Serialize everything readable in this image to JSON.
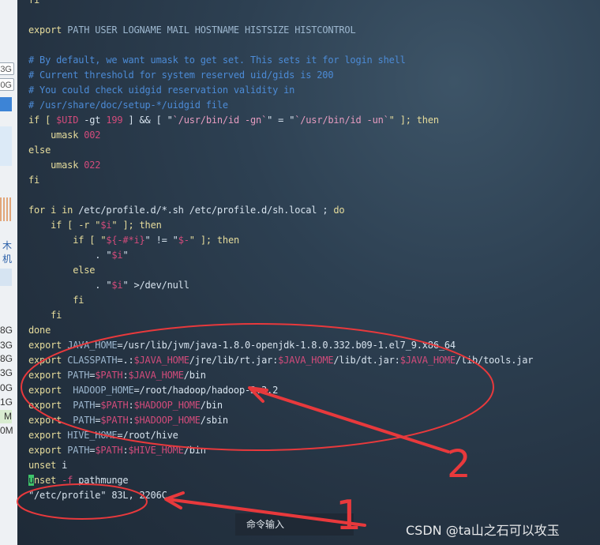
{
  "left_strip": {
    "fields": [
      "3G",
      "0G"
    ],
    "texts": [
      "木机",
      "8G",
      "3G",
      "8G",
      "3G",
      "0G",
      "1G",
      "M",
      "0M"
    ]
  },
  "terminal": {
    "lines": [
      {
        "segs": [
          [
            "fi",
            "kw"
          ]
        ]
      },
      {
        "segs": []
      },
      {
        "segs": [
          [
            "export ",
            "kw"
          ],
          [
            "PATH USER LOGNAME MAIL HOSTNAME HISTSIZE HISTCONTROL",
            "dim"
          ]
        ]
      },
      {
        "segs": []
      },
      {
        "segs": [
          [
            "# By default, we want umask to get set. This sets it for login shell",
            "cm"
          ]
        ]
      },
      {
        "segs": [
          [
            "# Current threshold for system reserved uid/gids is 200",
            "cm"
          ]
        ]
      },
      {
        "segs": [
          [
            "# You could check uidgid reservation validity in",
            "cm"
          ]
        ]
      },
      {
        "segs": [
          [
            "# /usr/share/doc/setup-*/uidgid file",
            "cm"
          ]
        ]
      },
      {
        "segs": [
          [
            "if [ ",
            "kw"
          ],
          [
            "$UID",
            "var"
          ],
          [
            " -gt ",
            ""
          ],
          [
            "199",
            "num"
          ],
          [
            " ] && [ \"",
            ""
          ],
          [
            "`/usr/bin/id -gn`",
            "str"
          ],
          [
            "\" = \"",
            ""
          ],
          [
            "`/usr/bin/id -un`",
            "str"
          ],
          [
            "\" ]; then",
            "kw"
          ]
        ]
      },
      {
        "segs": [
          [
            "    umask ",
            "kw"
          ],
          [
            "002",
            "num"
          ]
        ]
      },
      {
        "segs": [
          [
            "else",
            "kw"
          ]
        ]
      },
      {
        "segs": [
          [
            "    umask ",
            "kw"
          ],
          [
            "022",
            "num"
          ]
        ]
      },
      {
        "segs": [
          [
            "fi",
            "kw"
          ]
        ]
      },
      {
        "segs": []
      },
      {
        "segs": [
          [
            "for i in ",
            "kw"
          ],
          [
            "/etc/profile.d/*.sh /etc/profile.d/sh.local ; ",
            ""
          ],
          [
            "do",
            "kw"
          ]
        ]
      },
      {
        "segs": [
          [
            "    if [ -r \"",
            "kw"
          ],
          [
            "$i",
            "var"
          ],
          [
            "\" ]; then",
            "kw"
          ]
        ]
      },
      {
        "segs": [
          [
            "        if [ \"",
            "kw"
          ],
          [
            "${-#*i}",
            "var"
          ],
          [
            "\" != \"",
            ""
          ],
          [
            "$-",
            "var"
          ],
          [
            "\" ]; then",
            "kw"
          ]
        ]
      },
      {
        "segs": [
          [
            "            . \"",
            ""
          ],
          [
            "$i",
            "var"
          ],
          [
            "\"",
            ""
          ]
        ]
      },
      {
        "segs": [
          [
            "        else",
            "kw"
          ]
        ]
      },
      {
        "segs": [
          [
            "            . \"",
            ""
          ],
          [
            "$i",
            "var"
          ],
          [
            "\" >/dev/null",
            ""
          ]
        ]
      },
      {
        "segs": [
          [
            "        fi",
            "kw"
          ]
        ]
      },
      {
        "segs": [
          [
            "    fi",
            "kw"
          ]
        ]
      },
      {
        "segs": [
          [
            "done",
            "kw"
          ]
        ]
      },
      {
        "segs": [
          [
            "export ",
            "kw"
          ],
          [
            "JAVA_HOME",
            "dim"
          ],
          [
            "=/usr/lib/jvm/java-1.8.0-openjdk-1.8.0.332.b09-1.el7_9.x86_64",
            ""
          ]
        ]
      },
      {
        "segs": [
          [
            "export ",
            "kw"
          ],
          [
            "CLASSPATH",
            "dim"
          ],
          [
            "=.:",
            ""
          ],
          [
            "$JAVA_HOME",
            "var"
          ],
          [
            "/jre/lib/rt.jar:",
            ""
          ],
          [
            "$JAVA_HOME",
            "var"
          ],
          [
            "/lib/dt.jar:",
            ""
          ],
          [
            "$JAVA_HOME",
            "var"
          ],
          [
            "/lib/tools.jar",
            ""
          ]
        ]
      },
      {
        "segs": [
          [
            "export ",
            "kw"
          ],
          [
            "PATH",
            "dim"
          ],
          [
            "=",
            ""
          ],
          [
            "$PATH",
            "var"
          ],
          [
            ":",
            ""
          ],
          [
            "$JAVA_HOME",
            "var"
          ],
          [
            "/bin",
            ""
          ]
        ]
      },
      {
        "segs": [
          [
            "export  ",
            "kw"
          ],
          [
            "HADOOP_HOME",
            "dim"
          ],
          [
            "=/root/hadoop/hadoop-3.3.2",
            ""
          ]
        ]
      },
      {
        "segs": [
          [
            "export  ",
            "kw"
          ],
          [
            "PATH",
            "dim"
          ],
          [
            "=",
            ""
          ],
          [
            "$PATH",
            "var"
          ],
          [
            ":",
            ""
          ],
          [
            "$HADOOP_HOME",
            "var"
          ],
          [
            "/bin",
            ""
          ]
        ]
      },
      {
        "segs": [
          [
            "export  ",
            "kw"
          ],
          [
            "PATH",
            "dim"
          ],
          [
            "=",
            ""
          ],
          [
            "$PATH",
            "var"
          ],
          [
            ":",
            ""
          ],
          [
            "$HADOOP_HOME",
            "var"
          ],
          [
            "/sbin",
            ""
          ]
        ]
      },
      {
        "segs": [
          [
            "export ",
            "kw"
          ],
          [
            "HIVE_HOME",
            "dim"
          ],
          [
            "=/root/hive",
            ""
          ]
        ]
      },
      {
        "segs": [
          [
            "export ",
            "kw"
          ],
          [
            "PATH",
            "dim"
          ],
          [
            "=",
            ""
          ],
          [
            "$PATH",
            "var"
          ],
          [
            ":",
            ""
          ],
          [
            "$HIVE_HOME",
            "var"
          ],
          [
            "/bin",
            ""
          ]
        ]
      },
      {
        "segs": [
          [
            "unset ",
            "kw"
          ],
          [
            "i",
            ""
          ]
        ]
      },
      {
        "segs": [
          [
            "u",
            "cursor"
          ],
          [
            "nset ",
            "kw"
          ],
          [
            "-f ",
            "var"
          ],
          [
            "pathmunge",
            ""
          ]
        ]
      },
      {
        "segs": [
          [
            "\"/etc/profile\" 83L, 2206C",
            ""
          ]
        ]
      }
    ]
  },
  "annotations": {
    "label_1": "1",
    "label_2": "2",
    "color": "#e8393c"
  },
  "command_input_label": "命令输入",
  "watermark": "CSDN @ta山之石可以攻玉"
}
